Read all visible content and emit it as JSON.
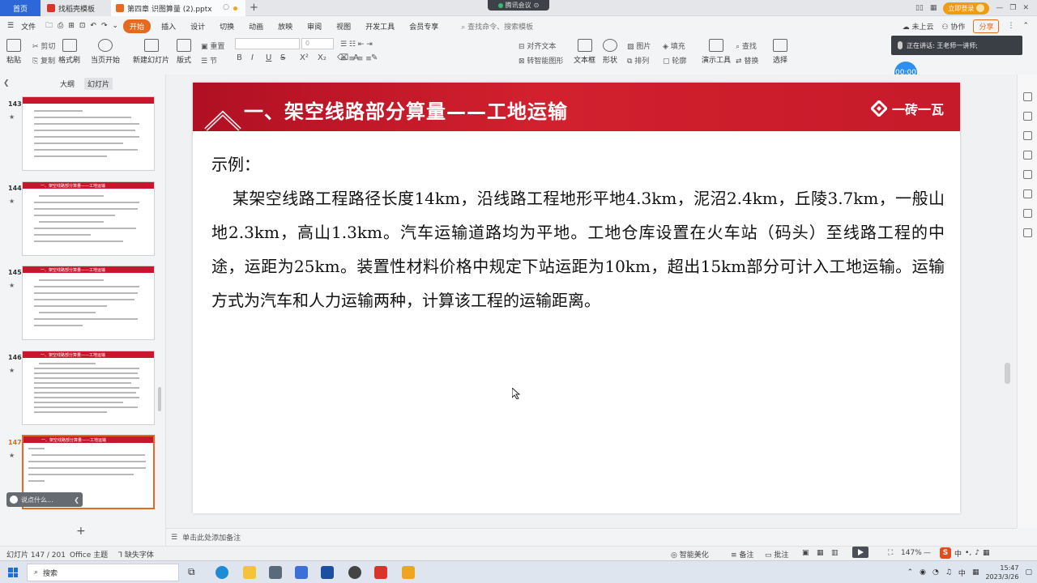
{
  "titlebar": {
    "home_tab": "首页",
    "tab1": "找稻壳模板",
    "tab2": "第四章 识图算量 (2).pptx",
    "meeting": "腾讯会议",
    "login_btn": "立即登录",
    "icons": [
      "window-layout-icon",
      "minimize-icon",
      "restore-icon",
      "close-icon"
    ]
  },
  "menubar": {
    "file": "文件",
    "items": [
      "开始",
      "插入",
      "设计",
      "切换",
      "动画",
      "放映",
      "审阅",
      "视图",
      "开发工具",
      "会员专享"
    ],
    "search_placeholder": "查找命令、搜索模板",
    "cloud": "未上云",
    "collab": "协作",
    "share": "分享"
  },
  "ribbon": {
    "paste": "粘贴",
    "cut": "剪切",
    "copy": "复制",
    "format_painter": "格式刷",
    "play_from_current": "当页开始",
    "new_slide": "新建幻灯片",
    "layout": "版式",
    "section": "节",
    "reset": "重置",
    "font_size": "0",
    "text_box": "文本框",
    "shape": "形状",
    "arrange": "排列",
    "picture": "图片",
    "fill": "填充",
    "outline": "轮廓",
    "presentation_tools": "演示工具",
    "find": "查找",
    "replace": "替换",
    "select": "选择",
    "align_text": "对齐文本",
    "convert_smartart": "转智能图形",
    "format_letters": [
      "B",
      "I",
      "U",
      "S"
    ]
  },
  "speech": {
    "label": "正在讲话: 王老师一讲师;",
    "timer": "00:00"
  },
  "leftpanel": {
    "tab_outline": "大纲",
    "tab_slides": "幻灯片",
    "slides": [
      {
        "num": "143",
        "title": ""
      },
      {
        "num": "144",
        "title": "一、架空线路部分算量——工地运输"
      },
      {
        "num": "145",
        "title": "一、架空线路部分算量——工地运输"
      },
      {
        "num": "146",
        "title": "一、架空线路部分算量——工地运输"
      },
      {
        "num": "147",
        "title": "一、架空线路部分算量——工地运输"
      }
    ],
    "ask": "说点什么..."
  },
  "slide": {
    "title": "一、架空线路部分算量——工地运输",
    "logo": "一砖一瓦",
    "subtitle": "示例：",
    "paragraph": "某架空线路工程路径长度14km，沿线路工程地形平地4.3km，泥沼2.4km，丘陵3.7km，一般山地2.3km，高山1.3km。汽车运输道路均为平地。工地仓库设置在火车站（码头）至线路工程的中途，运距为25km。装置性材料价格中规定下站运距为10km，超出15km部分可计入工地运输。运输方式为汽车和人力运输两种，计算该工程的运输距离。"
  },
  "notes": {
    "placeholder": "单击此处添加备注"
  },
  "statusbar": {
    "slide_count": "幻灯片 147 / 201",
    "theme": "Office 主题",
    "missing_font": "缺失字体",
    "beautify": "智能美化",
    "notes": "备注",
    "comments": "批注",
    "zoom": "147%"
  },
  "taskbar": {
    "search": "搜索",
    "time": "15:47",
    "date": "2023/3/26",
    "ime": "中"
  }
}
